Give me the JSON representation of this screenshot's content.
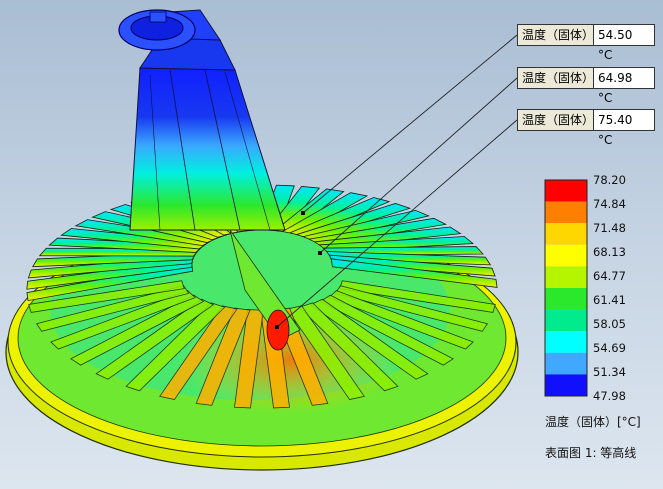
{
  "probes": [
    {
      "label": "温度（固体）",
      "value": "54.50 °C"
    },
    {
      "label": "温度（固体）",
      "value": "64.98 °C"
    },
    {
      "label": "温度（固体）",
      "value": "75.40 °C"
    }
  ],
  "legend": {
    "ticks": [
      "78.20",
      "74.84",
      "71.48",
      "68.13",
      "64.77",
      "61.41",
      "58.05",
      "54.69",
      "51.34",
      "47.98"
    ],
    "colors": [
      "#ff0000",
      "#ff7f00",
      "#ffd700",
      "#ffff00",
      "#b5f500",
      "#2ce82c",
      "#00ea8e",
      "#00ffff",
      "#40a8ff",
      "#1010ff"
    ],
    "title": "温度（固体）[°C]"
  },
  "caption": "表面图 1: 等高线"
}
